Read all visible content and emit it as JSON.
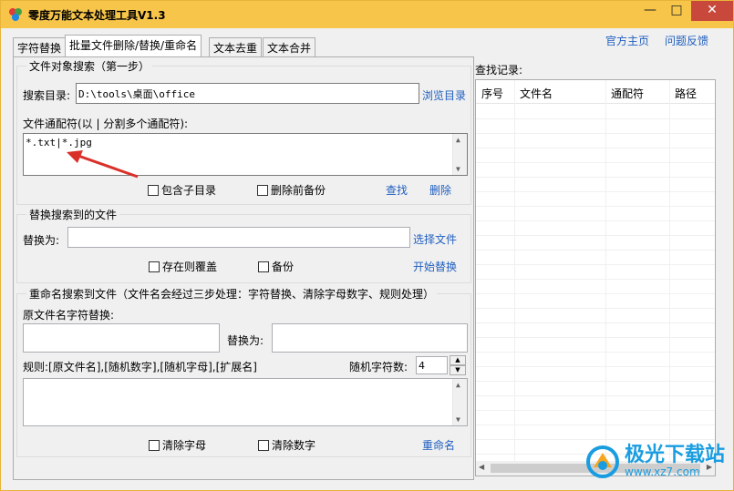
{
  "window": {
    "title": "零度万能文本处理工具V1.3",
    "controls": {
      "minimize": "—",
      "maximize": "□",
      "close": "✕"
    }
  },
  "tabs": [
    {
      "label": "字符替换"
    },
    {
      "label": "批量文件删除/替换/重命名"
    },
    {
      "label": "文本去重"
    },
    {
      "label": "文本合并"
    }
  ],
  "top_links": {
    "homepage": "官方主页",
    "feedback": "问题反馈"
  },
  "search_group": {
    "title": "文件对象搜索（第一步）",
    "dir_label": "搜索目录:",
    "dir_value": "D:\\tools\\桌面\\office",
    "browse": "浏览目录",
    "wildcard_label": "文件通配符(以 | 分割多个通配符):",
    "wildcard_value": "*.txt|*.jpg",
    "include_sub": "包含子目录",
    "backup_before_delete": "删除前备份",
    "find": "查找",
    "delete": "删除"
  },
  "replace_group": {
    "title": "替换搜索到的文件",
    "replace_label": "替换为:",
    "replace_value": "",
    "choose_file": "选择文件",
    "overwrite": "存在则覆盖",
    "backup": "备份",
    "start": "开始替换"
  },
  "rename_group": {
    "title": "重命名搜索到文件（文件名会经过三步处理：字符替换、清除字母数字、规则处理）",
    "orig_label": "原文件名字符替换:",
    "replace_label": "替换为:",
    "rule_label": "规则:[原文件名],[随机数字],[随机字母],[扩展名]",
    "random_count_label": "随机字符数:",
    "random_count": "4",
    "clear_letters": "清除字母",
    "clear_digits": "清除数字",
    "rename": "重命名"
  },
  "results": {
    "title": "查找记录:",
    "columns": [
      "序号",
      "文件名",
      "通配符",
      "路径"
    ]
  },
  "watermark": {
    "text": "极光下载站",
    "url": "www.xz7.com"
  },
  "colors": {
    "titlebar": "#f6c54a",
    "link": "#1f5fbf",
    "arrow": "#d9302a"
  }
}
